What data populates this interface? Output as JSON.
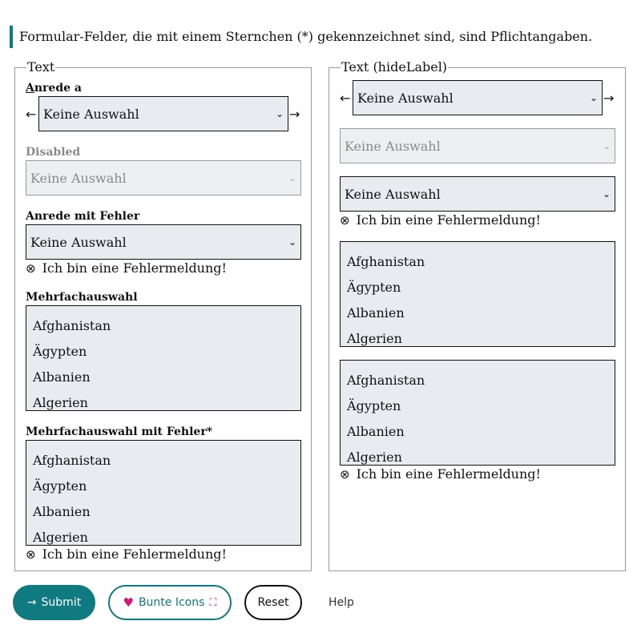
{
  "notice": "Formular-Felder, die mit einem Sternchen (*) gekennzeichnet sind, sind Pflichtangaben.",
  "left": {
    "legend": "Text",
    "anrede": {
      "label_accesskey": "A",
      "label_rest": "nrede a",
      "value": "Keine Auswahl"
    },
    "disabled": {
      "label": "Disabled",
      "value": "Keine Auswahl"
    },
    "anrede_error": {
      "label": "Anrede mit Fehler",
      "value": "Keine Auswahl",
      "error": "Ich bin eine Fehlermeldung!"
    },
    "multi": {
      "label": "Mehrfachauswahl",
      "options": [
        "Afghanistan",
        "Ägypten",
        "Albanien",
        "Algerien"
      ]
    },
    "multi_error": {
      "label": "Mehrfachauswahl mit Fehler*",
      "options": [
        "Afghanistan",
        "Ägypten",
        "Albanien",
        "Algerien"
      ],
      "error": "Ich bin eine Fehlermeldung!"
    }
  },
  "right": {
    "legend": "Text (hideLabel)",
    "anrede": {
      "value": "Keine Auswahl"
    },
    "disabled": {
      "value": "Keine Auswahl"
    },
    "anrede_error": {
      "value": "Keine Auswahl",
      "error": "Ich bin eine Fehlermeldung!"
    },
    "multi": {
      "options": [
        "Afghanistan",
        "Ägypten",
        "Albanien",
        "Algerien"
      ]
    },
    "multi_error": {
      "options": [
        "Afghanistan",
        "Ägypten",
        "Albanien",
        "Algerien"
      ],
      "error": "Ich bin eine Fehlermeldung!"
    }
  },
  "glyphs": {
    "arrow_left": "←",
    "arrow_right": "→",
    "chevron": "⌄",
    "error_icon": "⊗",
    "submit_arrow": "→",
    "heart": "♥",
    "puzzle": "⛶"
  },
  "buttons": {
    "submit": "Submit",
    "bunte": "Bunte Icons",
    "reset": "Reset",
    "help": "Help"
  },
  "colors": {
    "accent": "#0f7a80",
    "field_bg": "#e8ecf0",
    "heart": "#d6167a"
  }
}
